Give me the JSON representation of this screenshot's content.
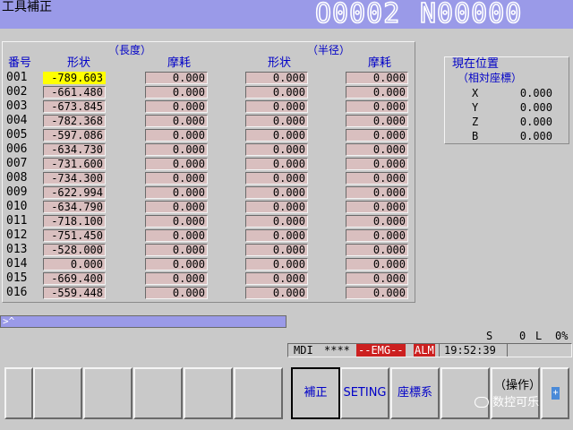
{
  "header": {
    "title": "工具補正",
    "program": "O0002",
    "sequence": "N00000"
  },
  "offset_table": {
    "group_length": "（長度）",
    "group_radius": "（半径）",
    "col_no": "番号",
    "col_shape1": "形状",
    "col_wear1": "摩耗",
    "col_shape2": "形状",
    "col_wear2": "摩耗",
    "rows": [
      {
        "no": "001",
        "len_shape": "-789.603",
        "len_wear": "0.000",
        "rad_shape": "0.000",
        "rad_wear": "0.000"
      },
      {
        "no": "002",
        "len_shape": "-661.480",
        "len_wear": "0.000",
        "rad_shape": "0.000",
        "rad_wear": "0.000"
      },
      {
        "no": "003",
        "len_shape": "-673.845",
        "len_wear": "0.000",
        "rad_shape": "0.000",
        "rad_wear": "0.000"
      },
      {
        "no": "004",
        "len_shape": "-782.368",
        "len_wear": "0.000",
        "rad_shape": "0.000",
        "rad_wear": "0.000"
      },
      {
        "no": "005",
        "len_shape": "-597.086",
        "len_wear": "0.000",
        "rad_shape": "0.000",
        "rad_wear": "0.000"
      },
      {
        "no": "006",
        "len_shape": "-634.730",
        "len_wear": "0.000",
        "rad_shape": "0.000",
        "rad_wear": "0.000"
      },
      {
        "no": "007",
        "len_shape": "-731.600",
        "len_wear": "0.000",
        "rad_shape": "0.000",
        "rad_wear": "0.000"
      },
      {
        "no": "008",
        "len_shape": "-734.300",
        "len_wear": "0.000",
        "rad_shape": "0.000",
        "rad_wear": "0.000"
      },
      {
        "no": "009",
        "len_shape": "-622.994",
        "len_wear": "0.000",
        "rad_shape": "0.000",
        "rad_wear": "0.000"
      },
      {
        "no": "010",
        "len_shape": "-634.790",
        "len_wear": "0.000",
        "rad_shape": "0.000",
        "rad_wear": "0.000"
      },
      {
        "no": "011",
        "len_shape": "-718.100",
        "len_wear": "0.000",
        "rad_shape": "0.000",
        "rad_wear": "0.000"
      },
      {
        "no": "012",
        "len_shape": "-751.450",
        "len_wear": "0.000",
        "rad_shape": "0.000",
        "rad_wear": "0.000"
      },
      {
        "no": "013",
        "len_shape": "-528.000",
        "len_wear": "0.000",
        "rad_shape": "0.000",
        "rad_wear": "0.000"
      },
      {
        "no": "014",
        "len_shape": "0.000",
        "len_wear": "0.000",
        "rad_shape": "0.000",
        "rad_wear": "0.000"
      },
      {
        "no": "015",
        "len_shape": "-669.400",
        "len_wear": "0.000",
        "rad_shape": "0.000",
        "rad_wear": "0.000"
      },
      {
        "no": "016",
        "len_shape": "-559.448",
        "len_wear": "0.000",
        "rad_shape": "0.000",
        "rad_wear": "0.000"
      }
    ]
  },
  "position": {
    "title": "現在位置",
    "subtitle": "（相対座標）",
    "axes": [
      {
        "name": "X",
        "value": "0.000"
      },
      {
        "name": "Y",
        "value": "0.000"
      },
      {
        "name": "Z",
        "value": "0.000"
      },
      {
        "name": "B",
        "value": "0.000"
      }
    ]
  },
  "input": {
    "prompt": ">^"
  },
  "status": {
    "s_label": "S",
    "s_value": "0",
    "l_label": "L",
    "l_value": "0%",
    "mode": "MDI",
    "stars": "****",
    "emg": "--EMG--",
    "alm": "ALM",
    "time": "19:52:39"
  },
  "softkeys": {
    "blank": "",
    "offset": "補正",
    "setting": "SETING",
    "coord": "座標系",
    "operation": "（操作）",
    "next": "+"
  },
  "watermark": "数控可乐"
}
